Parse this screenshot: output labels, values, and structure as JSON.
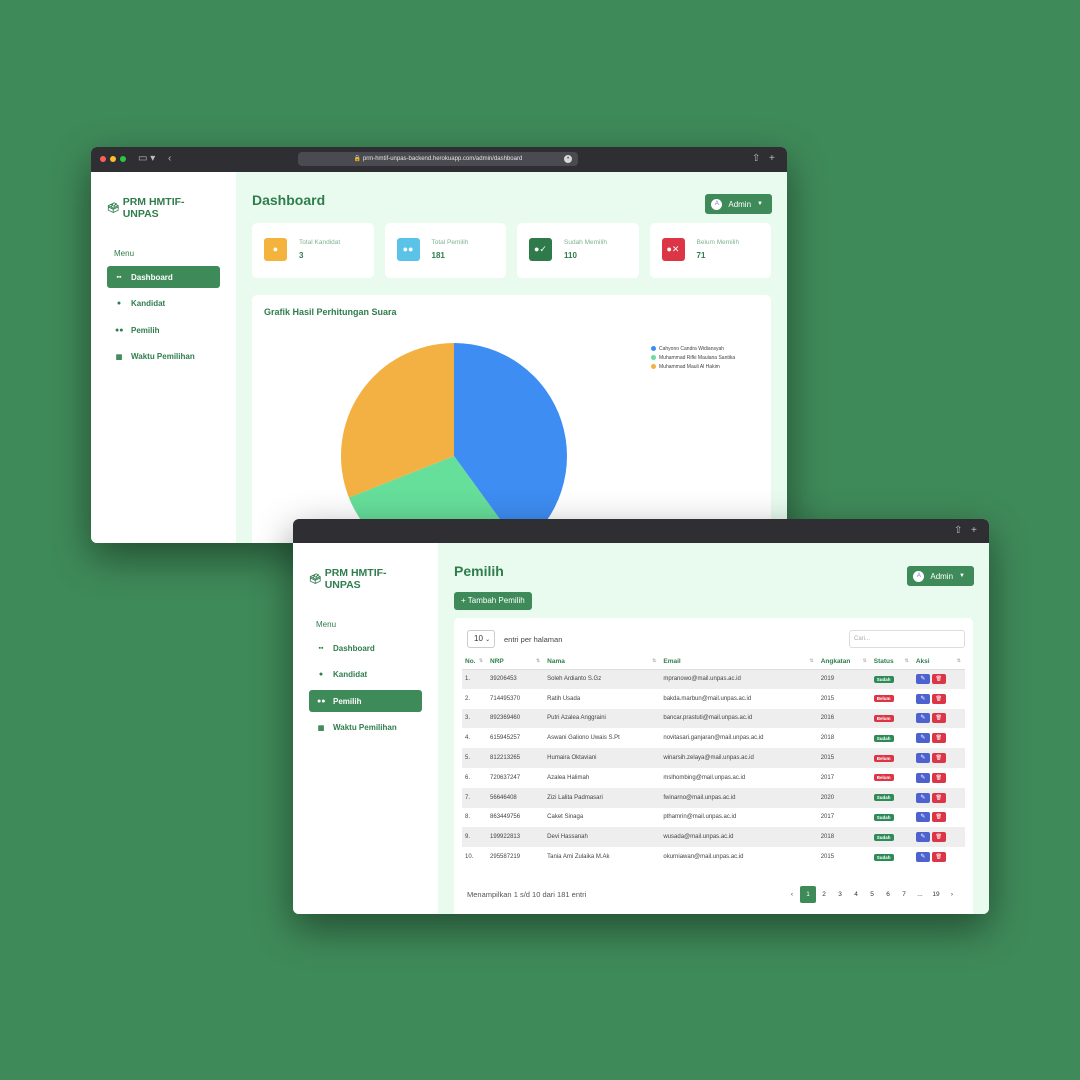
{
  "colors": {
    "background": "#3f8a59",
    "accent": "#3f8a59",
    "card_yellow": "#f4b33c",
    "card_blue": "#5bc3e8",
    "card_green": "#2e7a4a",
    "card_red": "#dc3545",
    "sudah": "#2e8b57",
    "belum": "#dc3545"
  },
  "window1": {
    "url": "prm-hmtif-unpas-backend.herokuapp.com/admin/dashboard",
    "brand": "PRM HMTIF-UNPAS",
    "menu_title": "Menu",
    "nav": [
      {
        "label": "Dashboard",
        "icon": "grid-icon"
      },
      {
        "label": "Kandidat",
        "icon": "user-icon"
      },
      {
        "label": "Pemilih",
        "icon": "users-icon"
      },
      {
        "label": "Waktu Pemilihan",
        "icon": "calendar-icon"
      }
    ],
    "page_title": "Dashboard",
    "admin_label": "Admin",
    "avatar_initial": "A",
    "cards": [
      {
        "label": "Total Kandidat",
        "value": "3",
        "icon": "user-icon"
      },
      {
        "label": "Total Pemilih",
        "value": "181",
        "icon": "users-icon"
      },
      {
        "label": "Sudah Memilih",
        "value": "110",
        "icon": "user-check-icon"
      },
      {
        "label": "Belum Memilih",
        "value": "71",
        "icon": "user-x-icon"
      }
    ],
    "chart_title": "Grafik Hasil Perhitungan Suara"
  },
  "chart_data": {
    "type": "pie",
    "title": "Grafik Hasil Perhitungan Suara",
    "legend_position": "top-right",
    "slices": [
      {
        "name": "Cahyono Candra Widiansyah",
        "value": 40,
        "color": "#3e8df3"
      },
      {
        "name": "Muhammad Rifki Maulana Santika",
        "value": 29,
        "color": "#66df9a"
      },
      {
        "name": "Muhammad Mauli Al Hakim",
        "value": 31,
        "color": "#f3b144"
      }
    ]
  },
  "window2": {
    "brand": "PRM HMTIF-UNPAS",
    "menu_title": "Menu",
    "nav": [
      {
        "label": "Dashboard",
        "icon": "grid-icon"
      },
      {
        "label": "Kandidat",
        "icon": "user-icon"
      },
      {
        "label": "Pemilih",
        "icon": "users-icon"
      },
      {
        "label": "Waktu Pemilihan",
        "icon": "calendar-icon"
      }
    ],
    "page_title": "Pemilih",
    "admin_label": "Admin",
    "avatar_initial": "A",
    "add_button": "+ Tambah Pemilih",
    "page_size": "10",
    "per_page_label": "entri per halaman",
    "search_placeholder": "Cari...",
    "columns": [
      "No.",
      "NRP",
      "Nama",
      "Email",
      "Angkatan",
      "Status",
      "Aksi"
    ],
    "rows": [
      {
        "no": "1.",
        "nrp": "39206453",
        "nama": "Soleh Ardianto S.Gz",
        "email": "mpranowo@mail.unpas.ac.id",
        "angkatan": "2019",
        "status": "Sudah"
      },
      {
        "no": "2.",
        "nrp": "714495370",
        "nama": "Ratih Usada",
        "email": "bakda.marbun@mail.unpas.ac.id",
        "angkatan": "2015",
        "status": "Belum"
      },
      {
        "no": "3.",
        "nrp": "892369460",
        "nama": "Putri Azalea Anggraini",
        "email": "bancar.prastuti@mail.unpas.ac.id",
        "angkatan": "2016",
        "status": "Belum"
      },
      {
        "no": "4.",
        "nrp": "615945257",
        "nama": "Aswani Galiono Uwais S.Pt",
        "email": "novitasari.ganjaran@mail.unpas.ac.id",
        "angkatan": "2018",
        "status": "Sudah"
      },
      {
        "no": "5.",
        "nrp": "812213265",
        "nama": "Humaira Oktaviani",
        "email": "winarsih.zelaya@mail.unpas.ac.id",
        "angkatan": "2015",
        "status": "Belum"
      },
      {
        "no": "6.",
        "nrp": "720637247",
        "nama": "Azalea Halimah",
        "email": "mslhombing@mail.unpas.ac.id",
        "angkatan": "2017",
        "status": "Belum"
      },
      {
        "no": "7.",
        "nrp": "56646408",
        "nama": "Zizi Lalita Padmasari",
        "email": "fwinarno@mail.unpas.ac.id",
        "angkatan": "2020",
        "status": "Sudah"
      },
      {
        "no": "8.",
        "nrp": "863449756",
        "nama": "Caket Sinaga",
        "email": "pthamrin@mail.unpas.ac.id",
        "angkatan": "2017",
        "status": "Sudah"
      },
      {
        "no": "9.",
        "nrp": "199922813",
        "nama": "Devi Hassanah",
        "email": "wusada@mail.unpas.ac.id",
        "angkatan": "2018",
        "status": "Sudah"
      },
      {
        "no": "10.",
        "nrp": "295587219",
        "nama": "Tania Ami Zulaika M.Ak",
        "email": "okurniawan@mail.unpas.ac.id",
        "angkatan": "2015",
        "status": "Sudah"
      }
    ],
    "footer_info": "Menampilkan 1 s/d 10 dari 181 entri",
    "pages": [
      "‹",
      "1",
      "2",
      "3",
      "4",
      "5",
      "6",
      "7",
      "...",
      "19",
      "›"
    ],
    "active_page": "1"
  }
}
